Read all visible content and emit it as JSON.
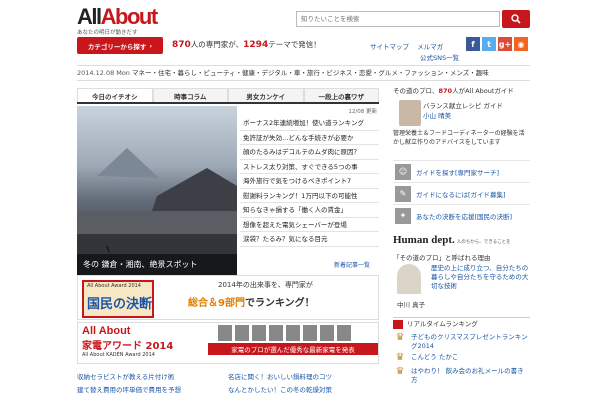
{
  "header": {
    "logo_prefix": "All",
    "logo_suffix": "About",
    "tagline": "あなたの明日が動きだす",
    "search_placeholder": "知りたいことを検索",
    "category_button": "カテゴリーから探す",
    "stats": {
      "experts_count": "870",
      "experts_text": "人の専門家が、",
      "themes_count": "1294",
      "themes_text": "テーマで発信！"
    },
    "links": [
      "サイトマップ",
      "メルマガ",
      "公式SNS一覧"
    ],
    "social": [
      {
        "name": "facebook",
        "glyph": "f",
        "color": "#3b5998"
      },
      {
        "name": "twitter",
        "glyph": "t",
        "color": "#55acee"
      },
      {
        "name": "google-plus",
        "glyph": "g+",
        "color": "#dd4b39"
      },
      {
        "name": "rss",
        "glyph": "◉",
        "color": "#f26522"
      }
    ]
  },
  "datebar": {
    "date": "2014.12.08",
    "day": "Mon",
    "categories": "マネー・住宅・暮らし・ビューティ・健康・デジタル・車・旅行・ビジネス・恋愛・グルメ・ファッション・メンズ・趣味"
  },
  "tabs": [
    "今日のイチオシ",
    "時事コラム",
    "男女カンケイ",
    "一段上の裏ワザ"
  ],
  "hero": {
    "caption": "冬の 鎌倉・湘南、絶景スポット"
  },
  "articles": {
    "date": "12/08 更新",
    "items": [
      "ボーナス2年連続増加！使い道ランキング",
      "免許証が失効…どんな手続きが必要か",
      "顔のたるみはデコルテのムダ肉に原因？",
      "ストレス太り対策、すぐできる5つの事",
      "海外旅行で気をつけるべきポイント7",
      "慰謝料ランキング！1万円以下の可能性",
      "知らなきゃ損する「働く人の賃金」",
      "想像を超えた電気シェーバーが登場",
      "涙袋？たるみ？気になる目元"
    ],
    "more": "新着記事一覧"
  },
  "banner1": {
    "small": "All About Award 2014",
    "big": "国民の決断",
    "line1": "2014年の出来事を、専門家が",
    "line2a": "総合＆9部門",
    "line2b": "でランキング！"
  },
  "banner2": {
    "title_en": "All About",
    "title_jp": "家電アワード 2014",
    "sub": "All About KADEN Award 2014",
    "strip": "家電のプロが選んだ優秀な最新家電を発表"
  },
  "bottom_links": [
    [
      "収納セラピストが教える片付け術",
      "名店に聞く！おいしい鍋料理のコツ"
    ],
    [
      "建て替え費用の坪単価で費用を予想",
      "なんとかしたい！この冬の乾燥対策"
    ]
  ],
  "right": {
    "pro_text_a": "その道のプロ、",
    "pro_count": "870",
    "pro_text_b": "人がAll Aboutガイド",
    "guide_title": "バランス献立レシピ ガイド",
    "guide_name": "小山 晴美",
    "guide_desc": "管理栄養士＆フードコーディネーターの経験を活かし献立作りのアドバイスをしています",
    "menu": [
      {
        "glyph": "☺",
        "label": "ガイドを探す[専門家サーチ]"
      },
      {
        "glyph": "✎",
        "label": "ガイドになるには[ガイド募集]"
      },
      {
        "glyph": "✦",
        "label": "あなたの決断を応援[国民の決断]"
      }
    ],
    "hdept_title": "Human dept.",
    "hdept_sub": "人のちから、できることを",
    "hdept_q": "「その道のプロ」と呼ばれる理由",
    "hdept_text": "歴史の上に成り立つ、自分たちの暮らしや自分たちを守るための大切な技術",
    "hdept_name": "中川 真子",
    "ranking_label": "リアルタイムランキング",
    "ranking": [
      "子どものクリスマスプレゼントランキング2014",
      "こんどう たかこ",
      "はやわり！ 飲み会のお礼メールの書き方"
    ]
  }
}
